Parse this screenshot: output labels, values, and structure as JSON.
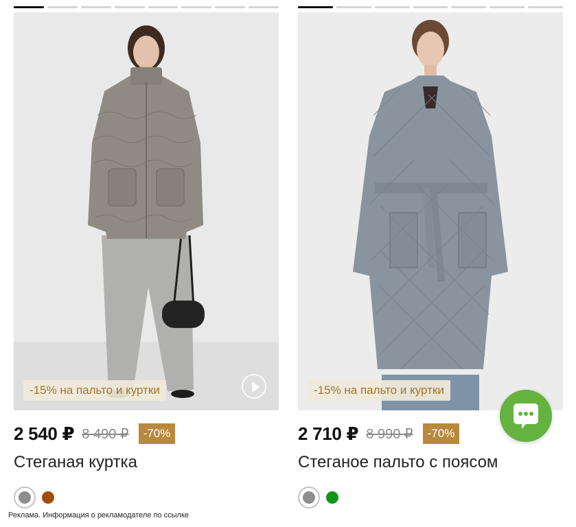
{
  "products": [
    {
      "promo": "-15% на пальто и куртки",
      "price": "2 540 ₽",
      "old_price": "8 490 ₽",
      "discount": "-70%",
      "title": "Стеганая куртка",
      "gallery_segments": 8,
      "gallery_active": 1,
      "photo_bg": "#e9e9e9",
      "jacket_color": "#8f8b84",
      "pants_color": "#b0b0ae",
      "colors": [
        "#8e8e8e",
        "#a24d0f"
      ],
      "has_video": true
    },
    {
      "promo": "-15% на пальто и куртки",
      "price": "2 710 ₽",
      "old_price": "8 990 ₽",
      "discount": "-70%",
      "title": "Стеганое пальто с поясом",
      "gallery_segments": 7,
      "gallery_active": 1,
      "photo_bg": "#ececec",
      "coat_color": "#8a949f",
      "colors": [
        "#8e8e8e",
        "#13951c"
      ],
      "has_video": false
    }
  ],
  "ad_note": "Реклама. Информация о рекламодателе по ссылке",
  "chat": {
    "icon": "chat-bubble-icon",
    "color": "#63b33e"
  }
}
